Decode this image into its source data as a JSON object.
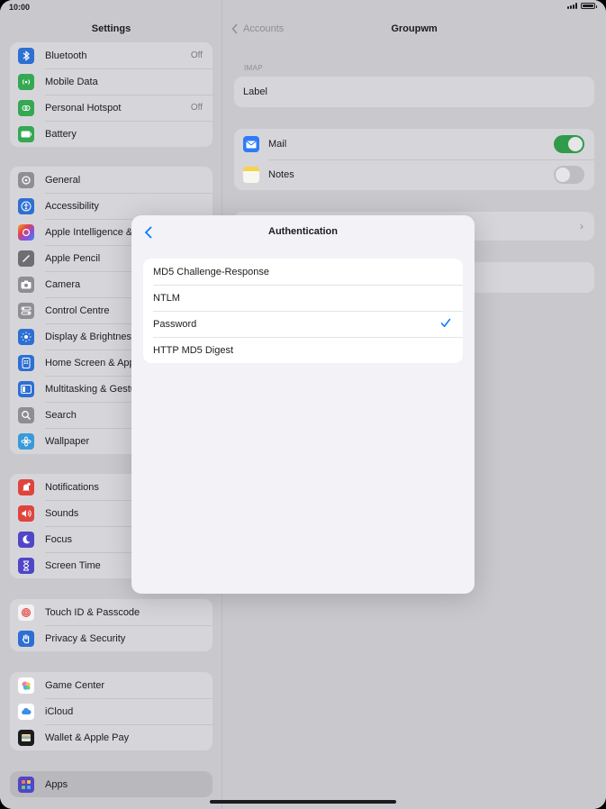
{
  "status_bar": {
    "time": "10:00"
  },
  "sidebar": {
    "title": "Settings",
    "groups": [
      [
        {
          "label": "Bluetooth",
          "value": "Off",
          "color": "#2e6fd3",
          "icon": "bluetooth-icon"
        },
        {
          "label": "Mobile Data",
          "value": "",
          "color": "#34a853",
          "icon": "antenna-icon"
        },
        {
          "label": "Personal Hotspot",
          "value": "Off",
          "color": "#34a853",
          "icon": "hotspot-icon"
        },
        {
          "label": "Battery",
          "value": "",
          "color": "#34a853",
          "icon": "battery-icon"
        }
      ],
      [
        {
          "label": "General",
          "color": "#8e8e93",
          "icon": "gear-icon"
        },
        {
          "label": "Accessibility",
          "color": "#2e6fd3",
          "icon": "accessibility-icon"
        },
        {
          "label": "Apple Intelligence & Siri",
          "color": "#e0644a",
          "icon": "siri-icon"
        },
        {
          "label": "Apple Pencil",
          "color": "#6e6e73",
          "icon": "pencil-icon"
        },
        {
          "label": "Camera",
          "color": "#8e8e93",
          "icon": "camera-icon"
        },
        {
          "label": "Control Centre",
          "color": "#8e8e93",
          "icon": "control-centre-icon"
        },
        {
          "label": "Display & Brightness",
          "color": "#2e6fd3",
          "icon": "sun-icon"
        },
        {
          "label": "Home Screen & App Library",
          "color": "#2e6fd3",
          "icon": "home-screen-icon"
        },
        {
          "label": "Multitasking & Gestures",
          "color": "#2e6fd3",
          "icon": "multitasking-icon"
        },
        {
          "label": "Search",
          "color": "#8e8e93",
          "icon": "search-icon"
        },
        {
          "label": "Wallpaper",
          "color": "#3a9ad9",
          "icon": "wallpaper-icon"
        }
      ],
      [
        {
          "label": "Notifications",
          "color": "#e0443e",
          "icon": "bell-icon"
        },
        {
          "label": "Sounds",
          "color": "#e0443e",
          "icon": "speaker-icon"
        },
        {
          "label": "Focus",
          "color": "#5046c7",
          "icon": "moon-icon"
        },
        {
          "label": "Screen Time",
          "color": "#5046c7",
          "icon": "hourglass-icon"
        }
      ],
      [
        {
          "label": "Touch ID & Passcode",
          "color": "#f2f2f2",
          "icon": "fingerprint-icon"
        },
        {
          "label": "Privacy & Security",
          "color": "#2e6fd3",
          "icon": "hand-icon"
        }
      ],
      [
        {
          "label": "Game Center",
          "color": "#ffffff",
          "icon": "game-center-icon"
        },
        {
          "label": "iCloud",
          "color": "#ffffff",
          "icon": "cloud-icon"
        },
        {
          "label": "Wallet & Apple Pay",
          "color": "#1c1c1e",
          "icon": "wallet-icon"
        }
      ],
      [
        {
          "label": "Apps",
          "color": "#5046c7",
          "icon": "apps-grid-icon"
        }
      ]
    ]
  },
  "detail": {
    "back_label": "Accounts",
    "title": "Groupwm",
    "section_header": "IMAP",
    "label_row": "Label",
    "toggles": [
      {
        "label": "Mail",
        "on": true,
        "icon": "mail-icon",
        "color": "#2e7cf6"
      },
      {
        "label": "Notes",
        "on": false,
        "icon": "notes-icon",
        "color": "#f7d24a"
      }
    ]
  },
  "modal": {
    "title": "Authentication",
    "options": [
      {
        "label": "MD5 Challenge-Response",
        "selected": false
      },
      {
        "label": "NTLM",
        "selected": false
      },
      {
        "label": "Password",
        "selected": true
      },
      {
        "label": "HTTP MD5 Digest",
        "selected": false
      }
    ]
  },
  "colors": {
    "accent": "#0a7aff",
    "toggle_on": "#34c759"
  }
}
